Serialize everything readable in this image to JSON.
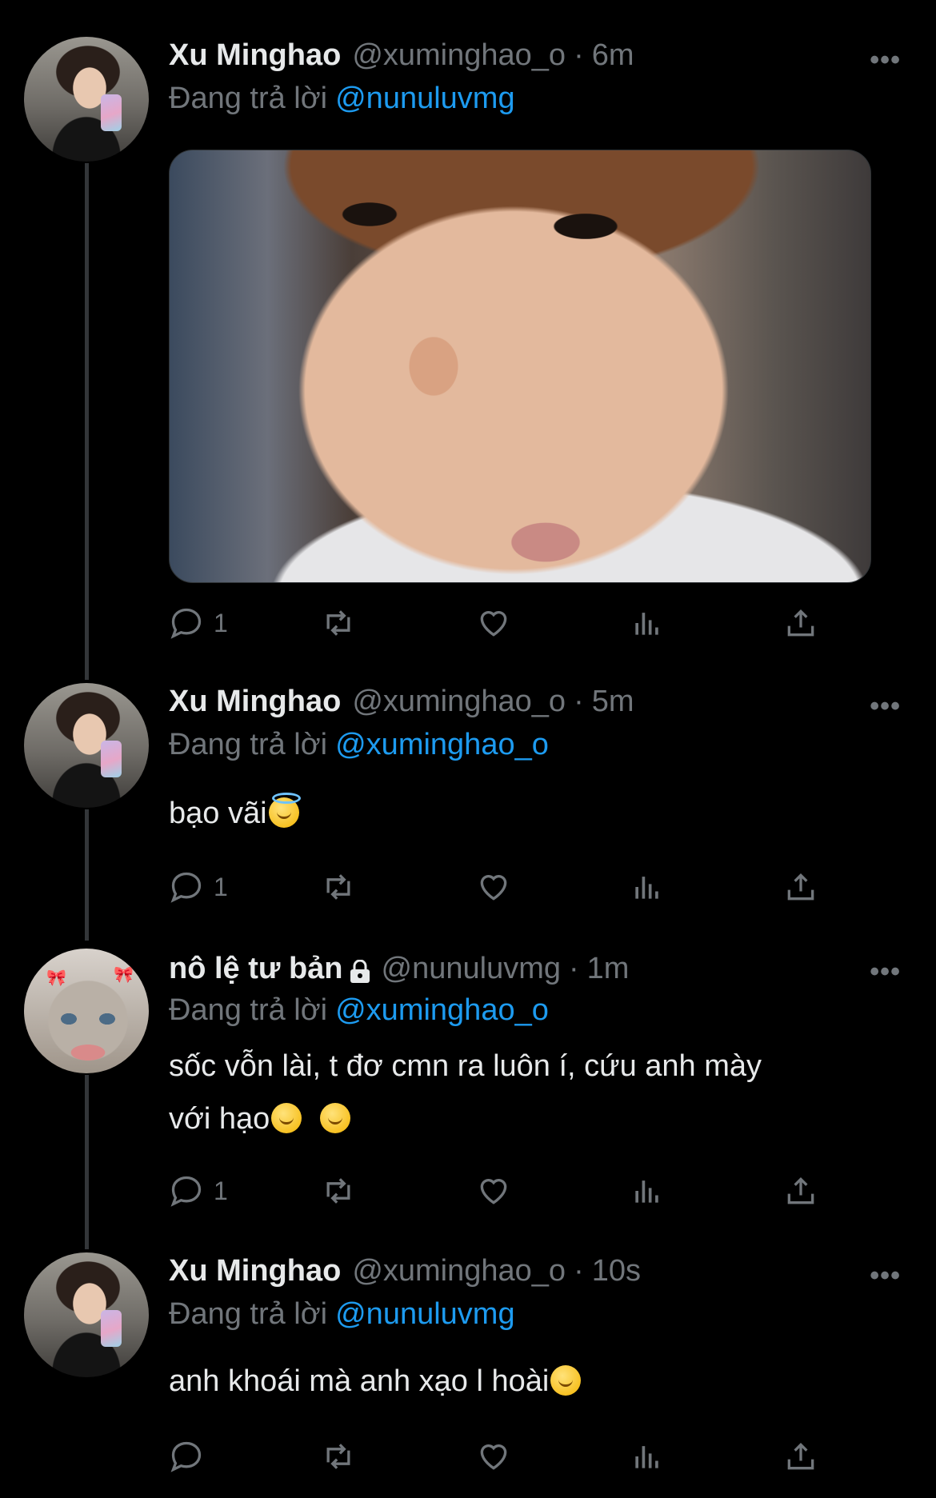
{
  "tweets": [
    {
      "name": "Xu Minghao",
      "handle": "@xuminghao_o",
      "time": "6m",
      "reply_prefix": "Đang trả lời",
      "reply_to": "@nunuluvmg",
      "text": "",
      "reply_count": "1"
    },
    {
      "name": "Xu Minghao",
      "handle": "@xuminghao_o",
      "time": "5m",
      "reply_prefix": "Đang trả lời",
      "reply_to": "@xuminghao_o",
      "text": "bạo vãi",
      "reply_count": "1"
    },
    {
      "name": "nô lệ tư bản",
      "handle": "@nunuluvmg",
      "time": "1m",
      "reply_prefix": "Đang trả lời",
      "reply_to": "@xuminghao_o",
      "text_line1": "sốc vỗn lài, t đơ cmn ra luôn í, cứu anh mày",
      "text_line2": "với hạo",
      "reply_count": "1"
    },
    {
      "name": "Xu Minghao",
      "handle": "@xuminghao_o",
      "time": "10s",
      "reply_prefix": "Đang trả lời",
      "reply_to": "@nunuluvmg",
      "text": "anh khoái mà anh xạo l hoài",
      "reply_count": ""
    }
  ],
  "ui": {
    "separator": "·",
    "more": "•••"
  },
  "colors": {
    "background": "#000000",
    "text": "#e7e9ea",
    "muted": "#71767b",
    "link": "#1d9bf0"
  }
}
